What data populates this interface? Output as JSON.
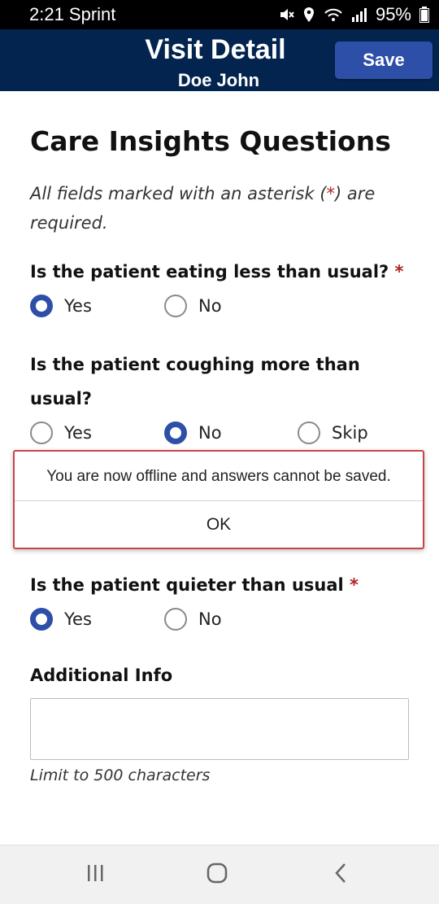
{
  "status_bar": {
    "time_carrier": "2:21 Sprint",
    "battery": "95%"
  },
  "header": {
    "title": "Visit Detail",
    "subtitle": "Doe John",
    "save_label": "Save"
  },
  "page": {
    "title": "Care Insights Questions",
    "required_note_pre": "All fields marked with an asterisk (",
    "required_note_star": "*",
    "required_note_post": ") are required."
  },
  "questions": [
    {
      "text": "Is the patient eating less than usual?",
      "required_mark": "*",
      "options": [
        {
          "label": "Yes",
          "checked": true
        },
        {
          "label": "No",
          "checked": false
        }
      ]
    },
    {
      "text": "Is the patient coughing more than usual?",
      "options": [
        {
          "label": "Yes",
          "checked": false
        },
        {
          "label": "No",
          "checked": true
        },
        {
          "label": "Skip",
          "checked": false
        }
      ]
    },
    {
      "text": "Is the patient quieter than usual",
      "required_mark": "*",
      "options": [
        {
          "label": "Yes",
          "checked": true
        },
        {
          "label": "No",
          "checked": false
        }
      ]
    }
  ],
  "dialog": {
    "message": "You are now offline and answers cannot be saved.",
    "ok_label": "OK"
  },
  "additional_info": {
    "label": "Additional Info",
    "value": "",
    "limit_text": "Limit to 500 characters"
  },
  "icons": {
    "mute": "mute-icon",
    "location": "location-icon",
    "volte": "volte-wifi-icon",
    "signal": "signal-icon",
    "battery": "battery-icon",
    "nav_recents": "recents-icon",
    "nav_home": "home-icon",
    "nav_back": "back-icon"
  },
  "colors": {
    "header_bg": "#03244f",
    "accent": "#2e4fa8",
    "asterisk": "#b22424",
    "dialog_border": "#c84646"
  }
}
